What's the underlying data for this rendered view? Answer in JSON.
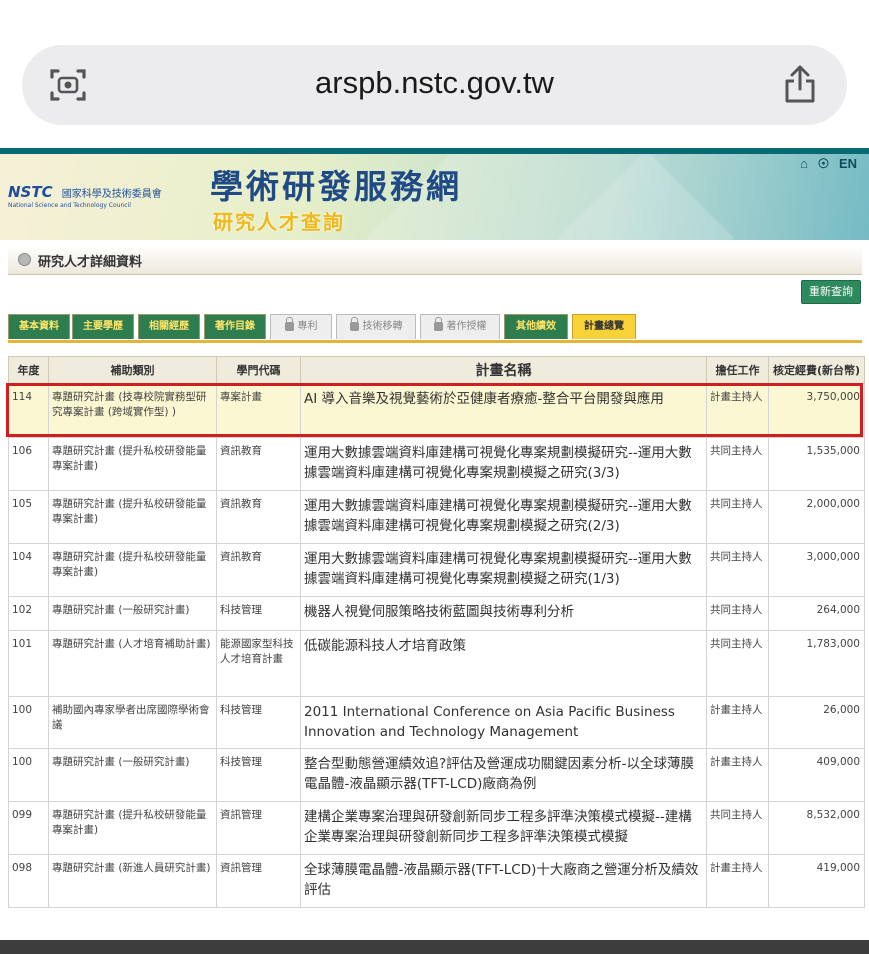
{
  "browser": {
    "url": "arspb.nstc.gov.tw"
  },
  "banner": {
    "logo_abbr": "NSTC",
    "logo_cn": "國家科學及技術委員會",
    "logo_en": "National Science and Technology Council",
    "title": "學術研發服務網",
    "subtitle": "研究人才查詢",
    "lang": "EN"
  },
  "section": {
    "title": "研究人才詳細資料",
    "requery_label": "重新查詢"
  },
  "tabs": [
    {
      "label": "基本資料",
      "state": "on"
    },
    {
      "label": "主要學歷",
      "state": "on"
    },
    {
      "label": "相關經歷",
      "state": "on"
    },
    {
      "label": "著作目錄",
      "state": "on"
    },
    {
      "label": "專利",
      "state": "off"
    },
    {
      "label": "技術移轉",
      "state": "off"
    },
    {
      "label": "著作授權",
      "state": "off"
    },
    {
      "label": "其他績效",
      "state": "on"
    },
    {
      "label": "計畫總覽",
      "state": "cur"
    }
  ],
  "table": {
    "headers": [
      "年度",
      "補助類別",
      "學門代碼",
      "計畫名稱",
      "擔任工作",
      "核定經費(新台幣)"
    ],
    "rows": [
      {
        "year": "114",
        "type": "專題研究計畫 (技專校院實務型研究專案計畫 (跨域實作型) )",
        "code": "專案計畫",
        "name": "AI 導入音樂及視覺藝術於亞健康者療癒-整合平台開發與應用",
        "role": "計畫主持人",
        "fee": "3,750,000"
      },
      {
        "year": "106",
        "type": "專題研究計畫 (提升私校研發能量專案計畫)",
        "code": "資訊教育",
        "name": "運用大數據雲端資料庫建構可視覺化專案規劃模擬研究--運用大數據雲端資料庫建構可視覺化專案規劃模擬之研究(3/3)",
        "role": "共同主持人",
        "fee": "1,535,000"
      },
      {
        "year": "105",
        "type": "專題研究計畫 (提升私校研發能量專案計畫)",
        "code": "資訊教育",
        "name": "運用大數據雲端資料庫建構可視覺化專案規劃模擬研究--運用大數據雲端資料庫建構可視覺化專案規劃模擬之研究(2/3)",
        "role": "共同主持人",
        "fee": "2,000,000"
      },
      {
        "year": "104",
        "type": "專題研究計畫 (提升私校研發能量專案計畫)",
        "code": "資訊教育",
        "name": "運用大數據雲端資料庫建構可視覺化專案規劃模擬研究--運用大數據雲端資料庫建構可視覺化專案規劃模擬之研究(1/3)",
        "role": "共同主持人",
        "fee": "3,000,000"
      },
      {
        "year": "102",
        "type": "專題研究計畫 (一般研究計畫)",
        "code": "科技管理",
        "name": "機器人視覺伺服策略技術藍圖與技術專利分析",
        "role": "共同主持人",
        "fee": "264,000"
      },
      {
        "year": "101",
        "type": "專題研究計畫 (人才培育補助計畫)",
        "code": "能源國家型科技人才培育計畫",
        "name": "低碳能源科技人才培育政策",
        "role": "共同主持人",
        "fee": "1,783,000"
      },
      {
        "year": "100",
        "type": "補助國內專家學者出席國際學術會議",
        "code": "科技管理",
        "name": "2011 International Conference on Asia Pacific Business Innovation and Technology Management",
        "role": "計畫主持人",
        "fee": "26,000"
      },
      {
        "year": "100",
        "type": "專題研究計畫 (一般研究計畫)",
        "code": "科技管理",
        "name": "整合型動態營運績效追?評估及營運成功關鍵因素分析-以全球薄膜電晶體-液晶顯示器(TFT-LCD)廠商為例",
        "role": "計畫主持人",
        "fee": "409,000"
      },
      {
        "year": "099",
        "type": "專題研究計畫 (提升私校研發能量專案計畫)",
        "code": "資訊管理",
        "name": "建構企業專案治理與研發創新同步工程多評準決策模式模擬--建構企業專案治理與研發創新同步工程多評準決策模式模擬",
        "role": "共同主持人",
        "fee": "8,532,000"
      },
      {
        "year": "098",
        "type": "專題研究計畫 (新進人員研究計畫)",
        "code": "資訊管理",
        "name": "全球薄膜電晶體-液晶顯示器(TFT-LCD)十大廠商之營運分析及績效評估",
        "role": "計畫主持人",
        "fee": "419,000"
      }
    ]
  }
}
